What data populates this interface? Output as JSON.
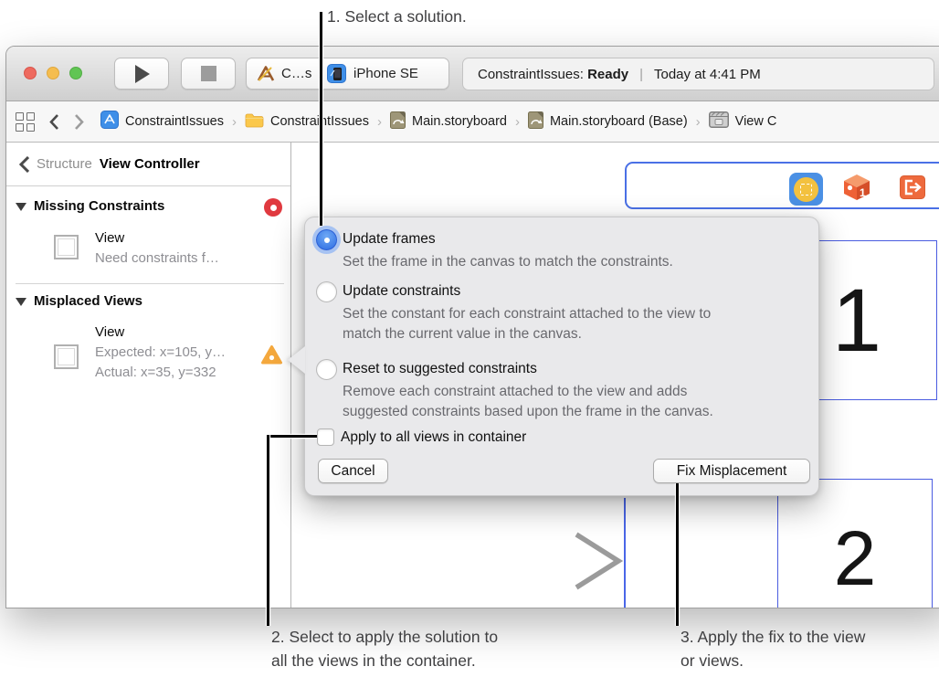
{
  "callouts": {
    "step1": "1. Select a solution.",
    "step2_line1": "2. Select to apply the solution to",
    "step2_line2": "all the views in the container.",
    "step3_line1": "3. Apply the fix to the view",
    "step3_line2": "or views."
  },
  "toolbar": {
    "scheme_label": "C…s",
    "device_label": "iPhone SE",
    "status_project": "ConstraintIssues:",
    "status_state": "Ready",
    "status_divider": "|",
    "status_time": "Today at 4:41 PM"
  },
  "jumpbar": {
    "separator": "›",
    "items": [
      {
        "icon": "project-icon",
        "label": "ConstraintIssues"
      },
      {
        "icon": "folder-icon",
        "label": "ConstraintIssues"
      },
      {
        "icon": "storyboard-icon",
        "label": "Main.storyboard"
      },
      {
        "icon": "storyboard-icon",
        "label": "Main.storyboard (Base)"
      },
      {
        "icon": "view-controller-icon",
        "label": "View C"
      }
    ]
  },
  "sidebar": {
    "back_label": "Structure",
    "title": "View Controller",
    "sections": [
      {
        "title": "Missing Constraints",
        "badge": "error",
        "items": [
          {
            "title": "View",
            "line2": "Need constraints f…"
          }
        ]
      },
      {
        "title": "Misplaced Views",
        "items": [
          {
            "title": "View",
            "line2": "Expected: x=105, y…",
            "line3": "Actual: x=35, y=332",
            "badge": "warning"
          }
        ]
      }
    ]
  },
  "popover": {
    "options": [
      {
        "label": "Update frames",
        "selected": true,
        "desc_lines": [
          "Set the frame in the canvas to match the constraints."
        ]
      },
      {
        "label": "Update constraints",
        "selected": false,
        "desc_lines": [
          "Set the constant for each constraint attached to the view to",
          "match the current value in the canvas."
        ]
      },
      {
        "label": "Reset to suggested constraints",
        "selected": false,
        "desc_lines": [
          "Remove each constraint attached to the view and adds",
          "suggested constraints based upon the frame in the canvas."
        ]
      }
    ],
    "checkbox_label": "Apply to all views in container",
    "cancel_label": "Cancel",
    "fix_label": "Fix Misplacement"
  },
  "canvas": {
    "view1_label": "1",
    "view2_label": "2",
    "dock_cube_badge": "1"
  },
  "colors": {
    "selection_blue": "#4a5ce0",
    "dock_blue": "#4b90e4",
    "warning_orange": "#f4a83d",
    "error_red": "#e0393f",
    "scene_yellow": "#f3c13f",
    "cube_orange": "#ee6136"
  }
}
